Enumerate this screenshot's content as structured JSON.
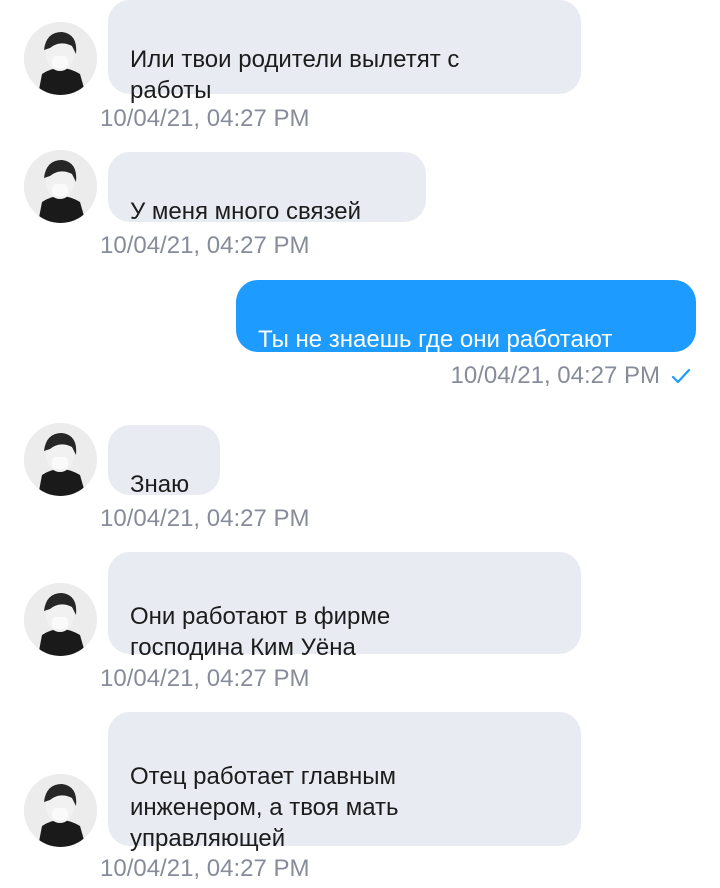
{
  "colors": {
    "incoming_bubble": "#e8ebf2",
    "outgoing_bubble": "#1e9bff",
    "timestamp": "#878c9a",
    "read_check": "#1e9bff"
  },
  "messages": [
    {
      "direction": "incoming",
      "text": "Или твои родители вылетят с\nработы",
      "timestamp": "10/04/21, 04:27 PM",
      "icon": "avatar"
    },
    {
      "direction": "incoming",
      "text": "У меня много связей",
      "timestamp": "10/04/21, 04:27 PM",
      "icon": "avatar"
    },
    {
      "direction": "outgoing",
      "text": "Ты не знаешь где они работают",
      "timestamp": "10/04/21, 04:27 PM",
      "status_icon": "checkmark-icon"
    },
    {
      "direction": "incoming",
      "text": "Знаю",
      "timestamp": "10/04/21, 04:27 PM",
      "icon": "avatar"
    },
    {
      "direction": "incoming",
      "text": "Они работают в фирме\nгосподина Ким Уёна",
      "timestamp": "10/04/21, 04:27 PM",
      "icon": "avatar"
    },
    {
      "direction": "incoming",
      "text": "Отец работает главным\nинженером, а твоя мать\nуправляющей",
      "timestamp": "10/04/21, 04:27 PM",
      "icon": "avatar"
    }
  ]
}
